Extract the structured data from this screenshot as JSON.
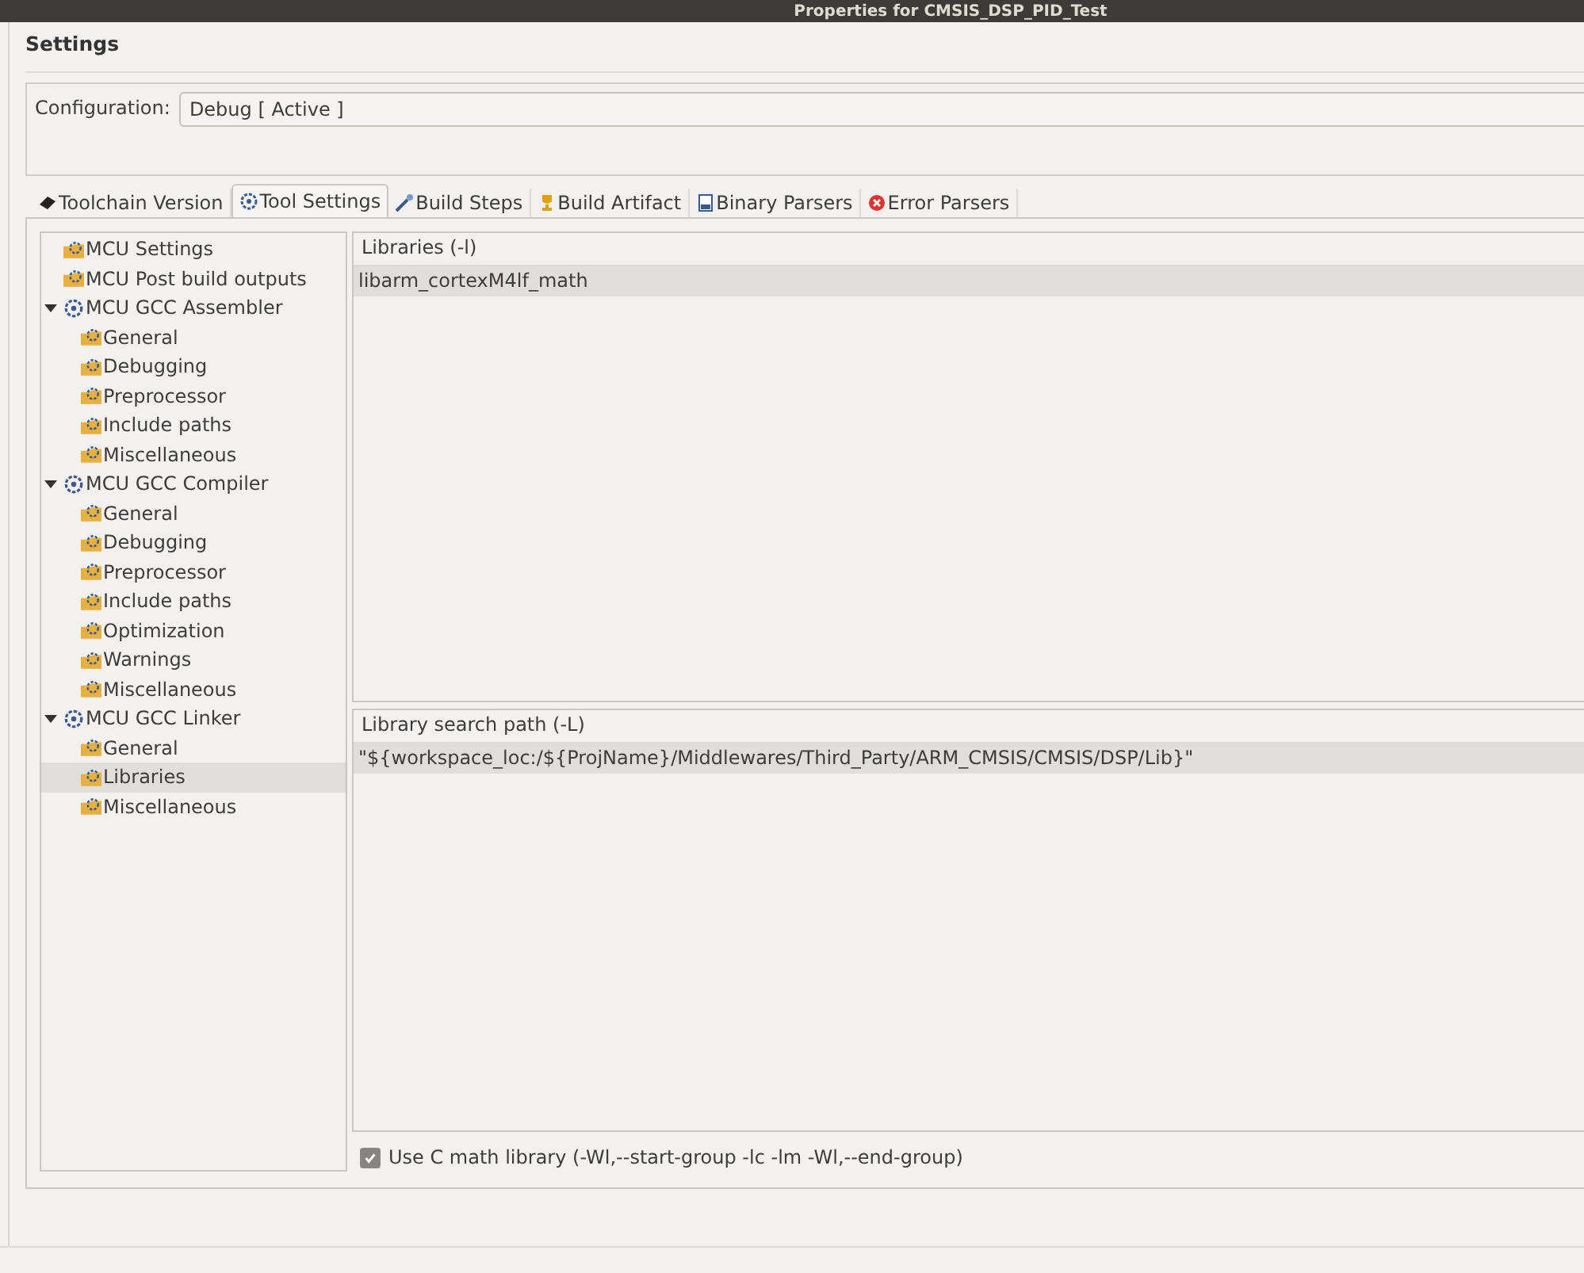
{
  "window": {
    "title": "Properties for CMSIS_DSP_PID_Test"
  },
  "header": "Settings",
  "configuration": {
    "label": "Configuration:",
    "value": "Debug  [ Active ]"
  },
  "tabs": [
    {
      "label": "Toolchain  Version",
      "kind": "chip",
      "selected": false
    },
    {
      "label": "Tool Settings",
      "kind": "gear",
      "selected": true
    },
    {
      "label": "Build Steps",
      "kind": "wand",
      "selected": false
    },
    {
      "label": "Build Artifact",
      "kind": "trophy",
      "selected": false
    },
    {
      "label": "Binary Parsers",
      "kind": "binary",
      "selected": false
    },
    {
      "label": "Error Parsers",
      "kind": "error",
      "selected": false
    }
  ],
  "tree": [
    {
      "label": "MCU Settings",
      "selected": false
    },
    {
      "label": "MCU Post build outputs",
      "selected": false
    },
    {
      "label": "MCU GCC Assembler",
      "expanded": true,
      "selected": false,
      "children": [
        {
          "label": "General",
          "selected": false
        },
        {
          "label": "Debugging",
          "selected": false
        },
        {
          "label": "Preprocessor",
          "selected": false
        },
        {
          "label": "Include paths",
          "selected": false
        },
        {
          "label": "Miscellaneous",
          "selected": false
        }
      ]
    },
    {
      "label": "MCU GCC Compiler",
      "expanded": true,
      "selected": false,
      "children": [
        {
          "label": "General",
          "selected": false
        },
        {
          "label": "Debugging",
          "selected": false
        },
        {
          "label": "Preprocessor",
          "selected": false
        },
        {
          "label": "Include paths",
          "selected": false
        },
        {
          "label": "Optimization",
          "selected": false
        },
        {
          "label": "Warnings",
          "selected": false
        },
        {
          "label": "Miscellaneous",
          "selected": false
        }
      ]
    },
    {
      "label": "MCU GCC Linker",
      "expanded": true,
      "selected": false,
      "children": [
        {
          "label": "General",
          "selected": false
        },
        {
          "label": "Libraries",
          "selected": true
        },
        {
          "label": "Miscellaneous",
          "selected": false
        }
      ]
    }
  ],
  "lists": [
    {
      "title": "Libraries (-l)",
      "items": [
        {
          "text": "libarm_cortexM4lf_math",
          "selected": true
        }
      ]
    },
    {
      "title": "Library search path (-L)",
      "items": [
        {
          "text": "\"${workspace_loc:/${ProjName}/Middlewares/Third_Party/ARM_CMSIS/CMSIS/DSP/Lib}\"",
          "selected": true
        }
      ]
    }
  ],
  "math_option": {
    "label": "Use C math library (-Wl,--start-group -lc -lm -Wl,--end-group)",
    "checked": true
  }
}
